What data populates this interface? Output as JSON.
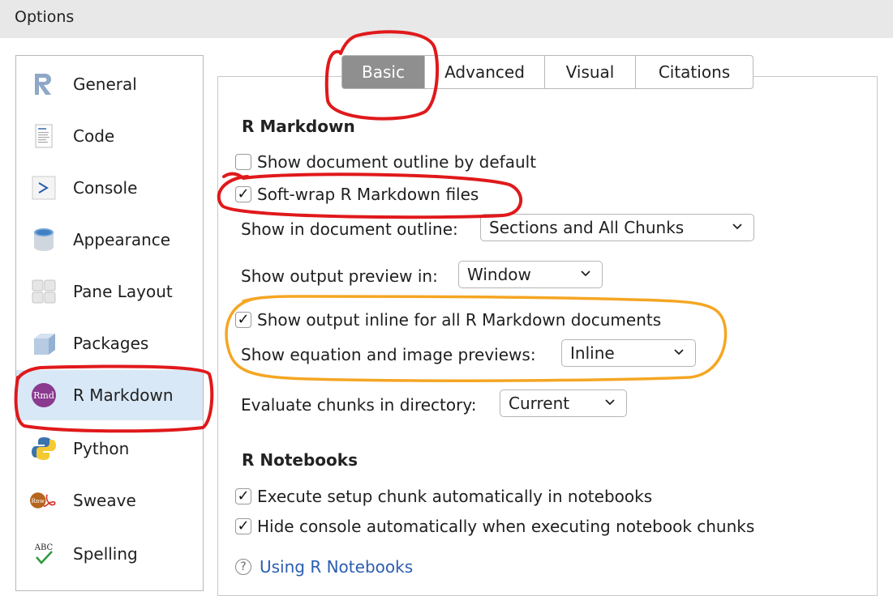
{
  "window": {
    "title": "Options"
  },
  "sidebar": {
    "items": [
      {
        "label": "General",
        "icon": "r-logo-icon"
      },
      {
        "label": "Code",
        "icon": "code-document-icon"
      },
      {
        "label": "Console",
        "icon": "console-prompt-icon"
      },
      {
        "label": "Appearance",
        "icon": "paint-bucket-icon"
      },
      {
        "label": "Pane Layout",
        "icon": "pane-grid-icon"
      },
      {
        "label": "Packages",
        "icon": "package-box-icon"
      },
      {
        "label": "R Markdown",
        "icon": "rmd-icon",
        "selected": true
      },
      {
        "label": "Python",
        "icon": "python-icon"
      },
      {
        "label": "Sweave",
        "icon": "sweave-icon"
      },
      {
        "label": "Spelling",
        "icon": "spelling-icon"
      }
    ],
    "rmd_badge": "Rmd",
    "rnw_badge": "Rnw",
    "abc_badge": "ABC"
  },
  "tabs": [
    {
      "label": "Basic",
      "active": true
    },
    {
      "label": "Advanced"
    },
    {
      "label": "Visual"
    },
    {
      "label": "Citations"
    }
  ],
  "rmarkdown": {
    "heading": "R Markdown",
    "show_outline_default": {
      "label": "Show document outline by default",
      "checked": false
    },
    "soft_wrap": {
      "label": "Soft-wrap R Markdown files",
      "checked": true
    },
    "outline_select": {
      "label": "Show in document outline:",
      "value": "Sections and All Chunks"
    },
    "preview_select": {
      "label": "Show output preview in:",
      "value": "Window"
    },
    "inline_output": {
      "label": "Show output inline for all R Markdown documents",
      "checked": true
    },
    "equation_select": {
      "label": "Show equation and image previews:",
      "value": "Inline"
    },
    "eval_dir_select": {
      "label": "Evaluate chunks in directory:",
      "value": "Current"
    }
  },
  "notebooks": {
    "heading": "R Notebooks",
    "setup_chunk": {
      "label": "Execute setup chunk automatically in notebooks",
      "checked": true
    },
    "hide_console": {
      "label": "Hide console automatically when executing notebook chunks",
      "checked": true
    },
    "help_link": "Using R Notebooks"
  },
  "check_mark": "✓",
  "help_glyph": "?",
  "colors": {
    "selected_bg": "#d8e8f6",
    "active_tab": "#8f8f8f",
    "red_annotation": "#e0191b",
    "orange_annotation": "#f5a623",
    "link": "#2a5db0"
  }
}
